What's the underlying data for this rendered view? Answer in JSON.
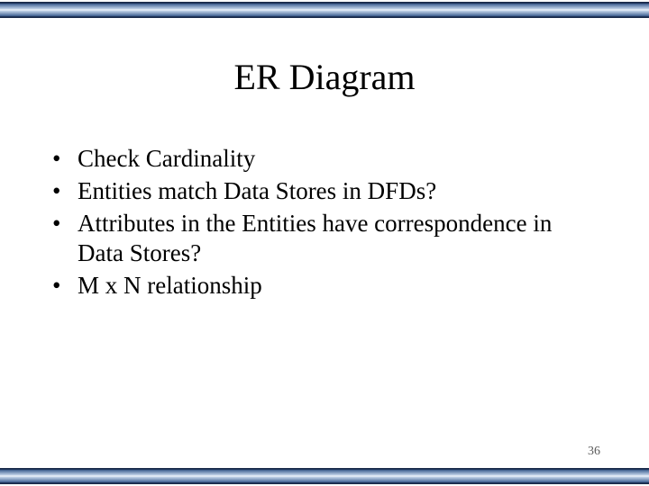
{
  "title": "ER Diagram",
  "bullets": [
    "Check Cardinality",
    "Entities match Data Stores in DFDs?",
    "Attributes in the Entities have correspondence in Data Stores?",
    "M x N relationship"
  ],
  "page_number": "36"
}
